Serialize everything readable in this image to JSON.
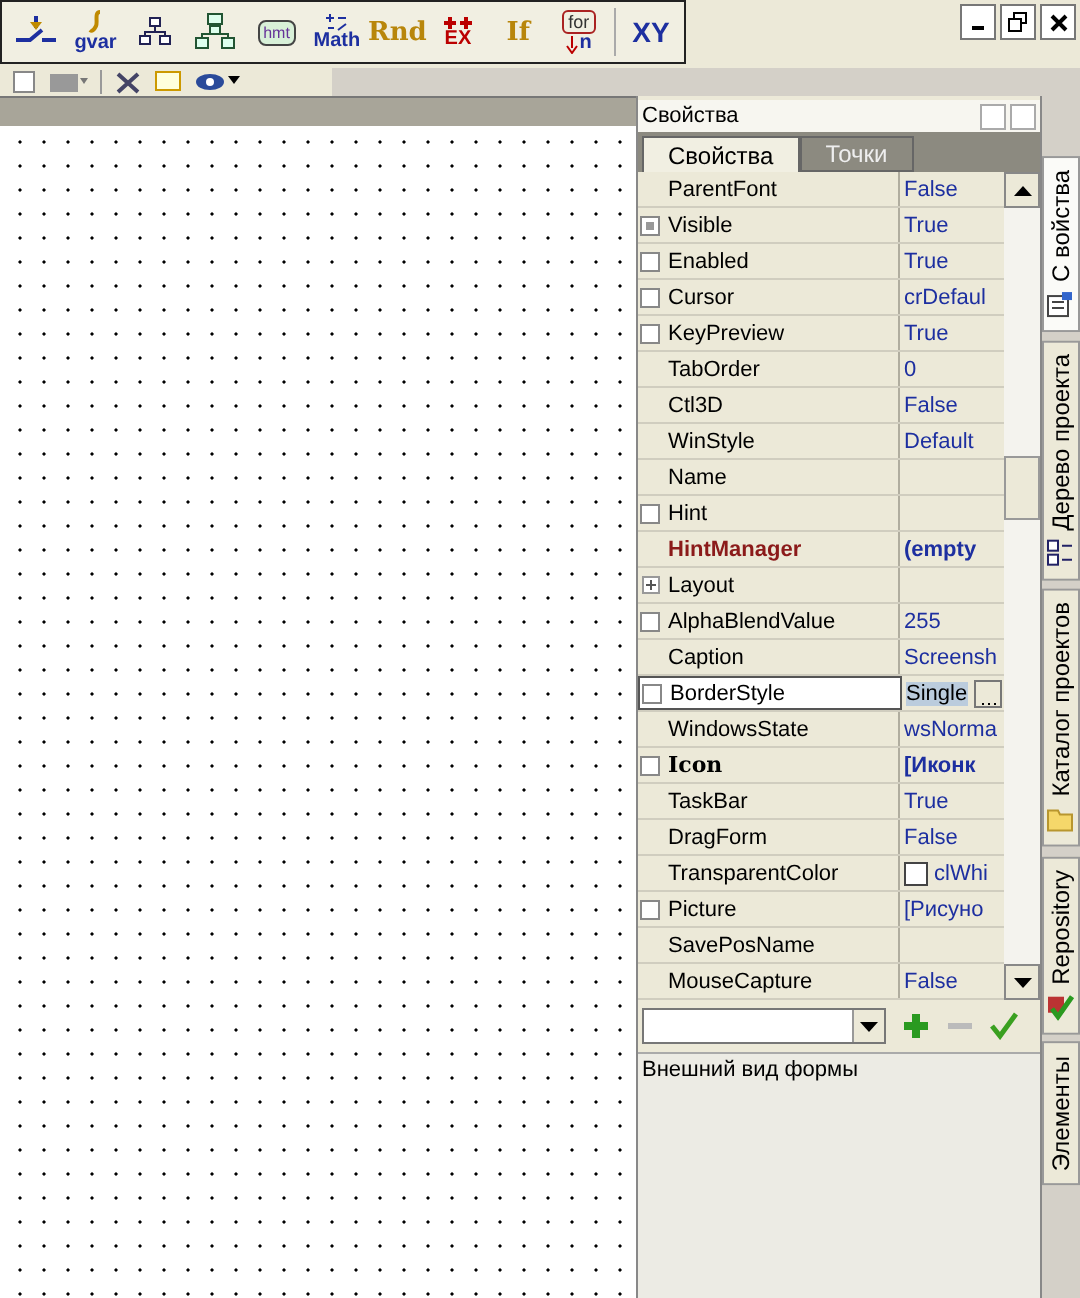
{
  "palette": [
    {
      "kind": "switch"
    },
    {
      "kind": "gvar",
      "label": "gvar"
    },
    {
      "kind": "tree"
    },
    {
      "kind": "blocks"
    },
    {
      "kind": "bubble",
      "label": "hmt"
    },
    {
      "kind": "math",
      "label": "Math"
    },
    {
      "kind": "word",
      "label": "Rnd"
    },
    {
      "kind": "ex",
      "label": "EX"
    },
    {
      "kind": "word",
      "label": "If"
    },
    {
      "kind": "loop",
      "label": "for",
      "sub": "n"
    },
    {
      "kind": "xy",
      "label": "XY"
    }
  ],
  "panel": {
    "title": "Свойства",
    "tabs": [
      {
        "label": "Свойства",
        "selected": true
      },
      {
        "label": "Точки",
        "selected": false
      }
    ],
    "rows": [
      {
        "name": "ParentFont",
        "value": "False",
        "kind": "plain",
        "selected": false
      },
      {
        "name": "Visible",
        "value": "True",
        "kind": "group",
        "expanded": true,
        "selected": false
      },
      {
        "name": "Enabled",
        "value": "True",
        "kind": "check",
        "selected": false
      },
      {
        "name": "Cursor",
        "value": "crDefaul",
        "kind": "check",
        "selected": false
      },
      {
        "name": "KeyPreview",
        "value": "True",
        "kind": "check",
        "selected": false
      },
      {
        "name": "TabOrder",
        "value": "0",
        "kind": "plain",
        "selected": false
      },
      {
        "name": "Ctl3D",
        "value": "False",
        "kind": "plain",
        "selected": false
      },
      {
        "name": "WinStyle",
        "value": "Default",
        "kind": "plain",
        "selected": false
      },
      {
        "name": "Name",
        "kind": "plain",
        "selected": false
      },
      {
        "name": "Hint",
        "kind": "check",
        "selected": false
      },
      {
        "name": "HintManager",
        "value": "(empty",
        "kind": "event",
        "selected": false
      },
      {
        "name": "Layout",
        "kind": "group",
        "expanded": false,
        "selected": false
      },
      {
        "name": "AlphaBlendValue",
        "value": "255",
        "kind": "check",
        "selected": false
      },
      {
        "name": "Caption",
        "value": "Screensh",
        "kind": "plain",
        "selected": false
      },
      {
        "name": "BorderStyle",
        "value": "Single",
        "kind": "check",
        "selected": true
      },
      {
        "name": "WindowsState",
        "value": "wsNorma",
        "kind": "plain",
        "selected": false
      },
      {
        "name": "Icon",
        "value": "[Иконк",
        "kind": "object",
        "selected": false
      },
      {
        "name": "TaskBar",
        "value": "True",
        "kind": "plain",
        "selected": false
      },
      {
        "name": "DragForm",
        "value": "False",
        "kind": "plain",
        "selected": false
      },
      {
        "name": "TransparentColor",
        "value": "clWhi",
        "kind": "plain",
        "selected": false,
        "color": "#ffffff"
      },
      {
        "name": "Picture",
        "value": "[Рисуно",
        "kind": "check",
        "selected": false
      },
      {
        "name": "SavePosName",
        "kind": "plain",
        "selected": false
      },
      {
        "name": "MouseCapture",
        "value": "False",
        "kind": "plain",
        "selected": false
      }
    ],
    "description": "Внешний вид формы"
  },
  "side_tabs": [
    {
      "label": "С войства",
      "selected": true
    },
    {
      "label": "Дерево проекта",
      "selected": false
    },
    {
      "label": "Каталог проектов",
      "selected": false
    },
    {
      "label": "Repository",
      "selected": false
    },
    {
      "label": "Элементы",
      "selected": false
    }
  ]
}
